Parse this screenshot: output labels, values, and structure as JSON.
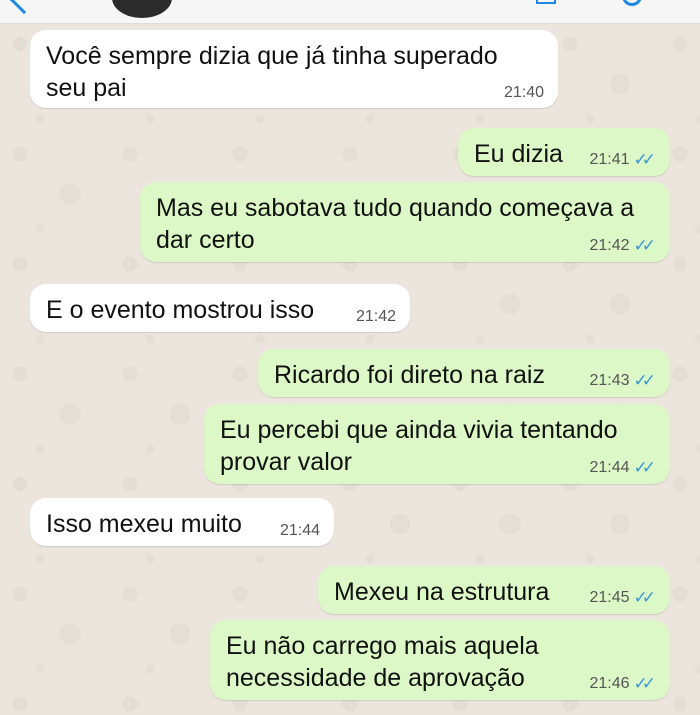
{
  "theme": {
    "incoming_bg": "#ffffff",
    "outgoing_bg": "#dcf8c6",
    "tick_color": "#3498db"
  },
  "header": {
    "back_icon": "back-arrow-icon",
    "avatar": "contact-avatar",
    "video_icon": "video-call-icon",
    "call_icon": "phone-call-icon"
  },
  "messages": [
    {
      "direction": "in",
      "text": "Você sempre dizia que já tinha superado seu pai",
      "time": "21:40"
    },
    {
      "direction": "out",
      "text": "Eu dizia",
      "time": "21:41",
      "status": "read"
    },
    {
      "direction": "out",
      "text": "Mas eu sabotava tudo quando começava a dar certo",
      "time": "21:42",
      "status": "read"
    },
    {
      "direction": "in",
      "text": "E o evento mostrou isso",
      "time": "21:42"
    },
    {
      "direction": "out",
      "text": "Ricardo foi direto na raiz",
      "time": "21:43",
      "status": "read"
    },
    {
      "direction": "out",
      "text": "Eu percebi que ainda vivia tentando provar valor",
      "time": "21:44",
      "status": "read"
    },
    {
      "direction": "in",
      "text": "Isso mexeu muito",
      "time": "21:44"
    },
    {
      "direction": "out",
      "text": "Mexeu na estrutura",
      "time": "21:45",
      "status": "read"
    },
    {
      "direction": "out",
      "text": "Eu não carrego mais aquela necessidade de aprovação",
      "time": "21:46",
      "status": "read"
    }
  ]
}
